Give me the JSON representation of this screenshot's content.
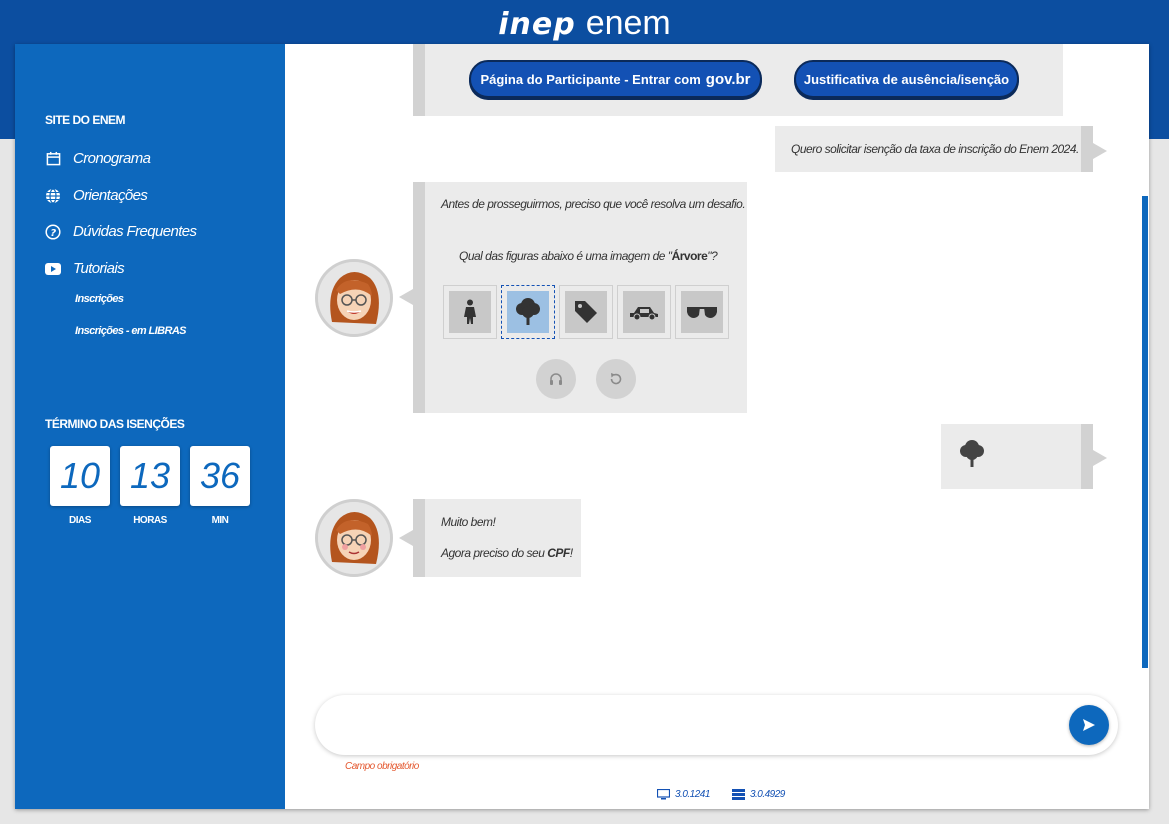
{
  "header": {
    "logo_inep": "inep",
    "logo_enem": "enem"
  },
  "sidebar": {
    "site_title": "SITE DO ENEM",
    "items": [
      {
        "label": "Cronograma",
        "icon": "calendar-icon"
      },
      {
        "label": "Orientações",
        "icon": "globe-icon"
      },
      {
        "label": "Dúvidas Frequentes",
        "icon": "help-circle-icon"
      },
      {
        "label": "Tutoriais",
        "icon": "youtube-icon"
      }
    ],
    "subitems": [
      "Inscrições",
      "Inscrições - em LIBRAS"
    ],
    "countdown_title": "TÉRMINO DAS ISENÇÕES",
    "countdown": [
      {
        "value": "10",
        "label": "DIAS"
      },
      {
        "value": "13",
        "label": "HORAS"
      },
      {
        "value": "36",
        "label": "MIN"
      }
    ]
  },
  "chat": {
    "buttons": {
      "participant_prefix": "Página do Participante - Entrar com",
      "participant_brand": "gov.br",
      "justification": "Justificativa de ausência/isenção"
    },
    "user_msg_1": "Quero solicitar isenção da taxa de inscrição do Enem 2024.",
    "captcha": {
      "intro": "Antes de prosseguirmos, preciso que você resolva um desafio.",
      "question_prefix": "Qual das figuras abaixo é uma imagem de \"",
      "question_target": "Árvore",
      "question_suffix": "\"?",
      "options": [
        "person-icon",
        "tree-icon",
        "tag-icon",
        "car-icon",
        "sunglasses-icon"
      ],
      "selected_index": 1
    },
    "user_msg_2_icon": "tree-icon",
    "bot_msg_2_line1": "Muito bem!",
    "bot_msg_2_line2_prefix": "Agora preciso do seu ",
    "bot_msg_2_line2_bold": "CPF",
    "bot_msg_2_line2_suffix": "!"
  },
  "input": {
    "placeholder": "",
    "required_text": "Campo obrigatório"
  },
  "footer": {
    "client_version": "3.0.1241",
    "server_version": "3.0.4929"
  },
  "colors": {
    "primary": "#0d68bd",
    "header": "#0c4ea0",
    "button": "#1351b4",
    "error": "#e4572e"
  }
}
